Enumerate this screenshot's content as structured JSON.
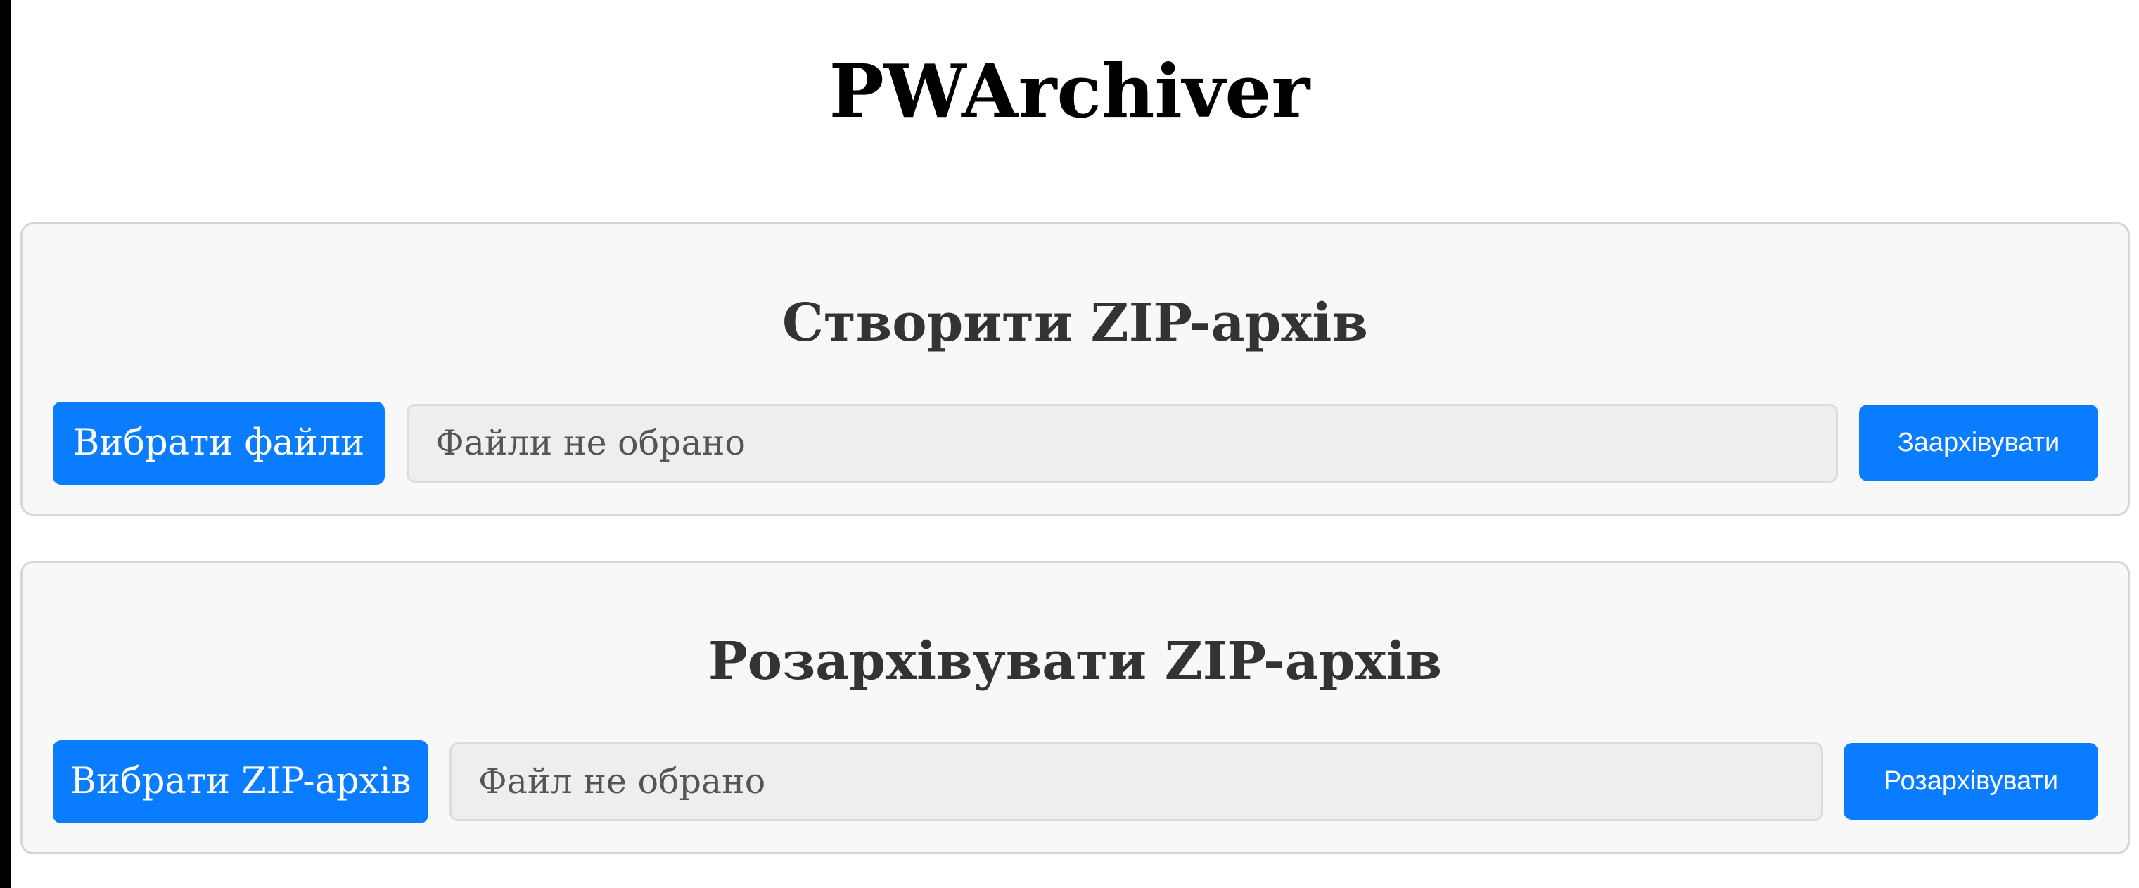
{
  "app": {
    "title": "PWArchiver"
  },
  "zip_section": {
    "title": "Створити ZIP-архів",
    "pick_label": "Вибрати файли",
    "file_status": "Файли не обрано",
    "action_label": "Заархівувати"
  },
  "unzip_section": {
    "title": "Розархівувати ZIP-архів",
    "pick_label": "Вибрати ZIP-архів",
    "file_status": "Файл не обрано",
    "action_label": "Розархівувати"
  },
  "colors": {
    "accent": "#0a7cff",
    "panel_background": "#f8f8f8",
    "panel_border": "#d6d6d6",
    "field_background": "#eeeeee",
    "title_text": "#000000",
    "section_title_text": "#333333"
  }
}
